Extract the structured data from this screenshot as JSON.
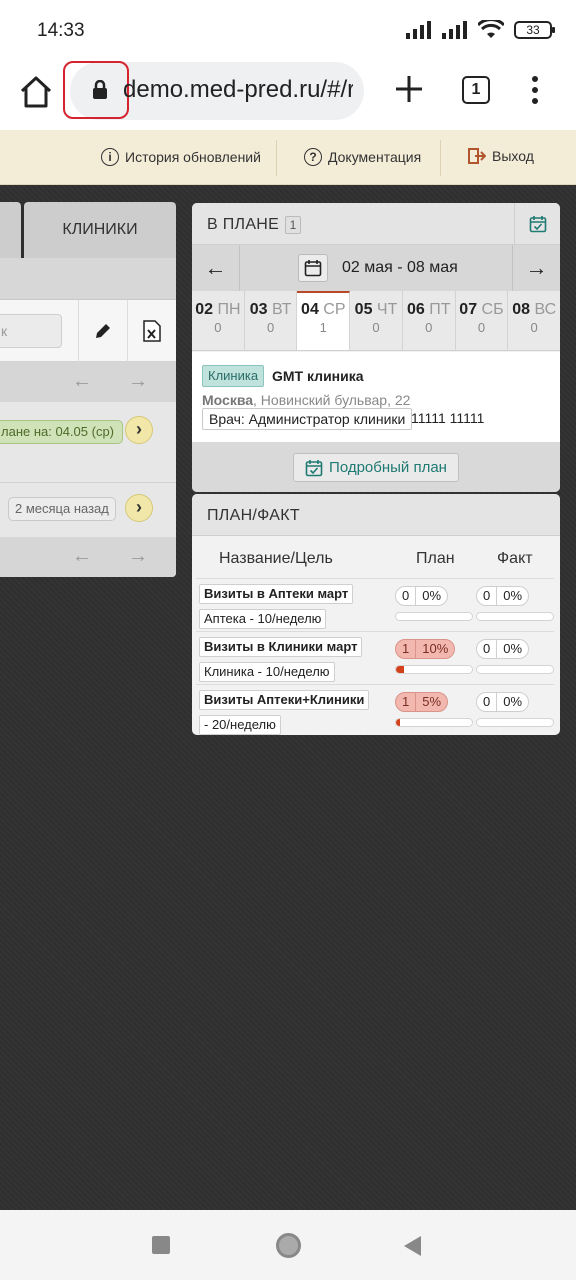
{
  "status_bar": {
    "time": "14:33",
    "battery": "33"
  },
  "browser": {
    "url": "demo.med-pred.ru/#/r",
    "tab_count": "1"
  },
  "header_links": [
    {
      "label": "История обновлений",
      "icon": "info-icon"
    },
    {
      "label": "Документация",
      "icon": "help-icon"
    },
    {
      "label": "Выход",
      "icon": "logout-icon"
    }
  ],
  "left_panel": {
    "tab_label": "КЛИНИКИ",
    "search_placeholder": "к",
    "rows": [
      {
        "badge": "лане на: 04.05 (ср)"
      },
      {
        "badge": "2 месяца назад"
      }
    ]
  },
  "plan": {
    "title": "В плане",
    "count": "1",
    "date_range": "02 мая - 08 мая",
    "days": [
      {
        "num": "02",
        "name": "ПН",
        "count": "0",
        "active": false
      },
      {
        "num": "03",
        "name": "ВТ",
        "count": "0",
        "active": false
      },
      {
        "num": "04",
        "name": "СР",
        "count": "1",
        "active": true
      },
      {
        "num": "05",
        "name": "ЧТ",
        "count": "0",
        "active": false
      },
      {
        "num": "06",
        "name": "ПТ",
        "count": "0",
        "active": false
      },
      {
        "num": "07",
        "name": "СБ",
        "count": "0",
        "active": false
      },
      {
        "num": "08",
        "name": "ВС",
        "count": "0",
        "active": false
      }
    ],
    "visit": {
      "type": "Клиника",
      "name": "GMT клиника",
      "city": "Москва",
      "address": ", Новинский бульвар, 22",
      "doctor": "Врач: Администратор клиники",
      "phone": "11111 11111"
    },
    "detail_button": "Подробный план"
  },
  "plan_fact": {
    "title": "План/факт",
    "columns": {
      "name": "Название/Цель",
      "plan": "План",
      "fact": "Факт"
    },
    "rows": [
      {
        "name": "Визиты в Аптеки март",
        "goal": "Аптека - 10/неделю",
        "plan_n": "0",
        "plan_pct": "0%",
        "plan_frac": 0,
        "fact_n": "0",
        "fact_pct": "0%",
        "fact_frac": 0
      },
      {
        "name": "Визиты в Клиники март",
        "goal": "Клиника - 10/неделю",
        "plan_n": "1",
        "plan_pct": "10%",
        "plan_frac": 0.1,
        "fact_n": "0",
        "fact_pct": "0%",
        "fact_frac": 0
      },
      {
        "name": "Визиты Аптеки+Клиники",
        "goal": "- 20/неделю",
        "plan_n": "1",
        "plan_pct": "5%",
        "plan_frac": 0.05,
        "fact_n": "0",
        "fact_pct": "0%",
        "fact_frac": 0
      }
    ]
  },
  "colors": {
    "accent_teal": "#1f7a72",
    "progress_red": "#d4421c",
    "header_bg": "#f3ecd7"
  }
}
